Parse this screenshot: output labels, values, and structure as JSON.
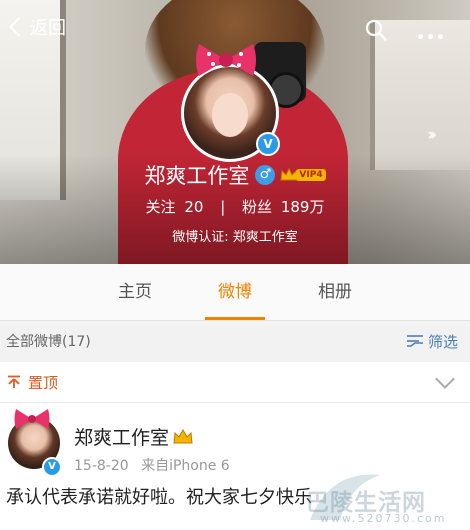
{
  "nav": {
    "back_label": "返回"
  },
  "profile": {
    "name": "郑爽工作室",
    "gender_symbol": "♂",
    "vip_label": "VIP4",
    "following_label": "关注",
    "following_count": "20",
    "followers_label": "粉丝",
    "followers_count": "189万",
    "verification": "微博认证: 郑爽工作室",
    "verified_mark": "V"
  },
  "tabs": [
    {
      "label": "主页",
      "active": false
    },
    {
      "label": "微博",
      "active": true
    },
    {
      "label": "相册",
      "active": false
    }
  ],
  "list_header": {
    "count_label": "全部微博(17)",
    "filter_label": "筛选"
  },
  "pinned": {
    "label": "置顶"
  },
  "post": {
    "author": "郑爽工作室",
    "date": "15-8-20",
    "source": "来自iPhone 6",
    "text": "承认代表承诺就好啦。祝大家七夕快乐",
    "verified_mark": "V"
  },
  "watermark": {
    "text": "巴陵生活网",
    "url": "www.520730.com"
  },
  "colors": {
    "accent": "#f08300",
    "pinned": "#e05a22",
    "link": "#4a7fb8",
    "verified": "#2c9be6"
  },
  "icons": [
    "chevron-left-icon",
    "search-icon",
    "more-icon",
    "double-chevron-icon",
    "gender-male-icon",
    "vip-crown-icon",
    "filter-icon",
    "pin-icon",
    "chevron-down-icon"
  ]
}
